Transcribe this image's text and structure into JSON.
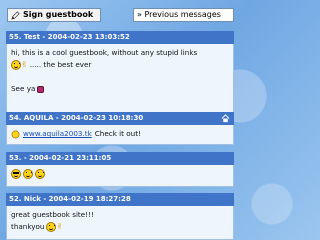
{
  "toolbar": {
    "sign_label": "Sign guestbook",
    "nav_select_value": "» Previous messages"
  },
  "entries": [
    {
      "header": "55. Test - 2004-02-23 13:03:52",
      "lines": [
        "hi, this is a cool guestbook, without any stupid links",
        "..... the best ever",
        "See ya"
      ]
    },
    {
      "header": "54. AQUILA - 2004-02-23 10:18:30",
      "link_text": "www.aquila2003.tk",
      "link_suffix": "Check it out!"
    },
    {
      "header": "53. - 2004-02-21 23:11:05"
    },
    {
      "header": "52. Nick - 2004-02-19 18:27:28",
      "lines": [
        "great guestbook site!!!",
        "thankyou"
      ]
    }
  ],
  "colors": {
    "header_bg": "#3f74c8",
    "body_bg": "#eef5fd",
    "link": "#1a4fb0"
  }
}
